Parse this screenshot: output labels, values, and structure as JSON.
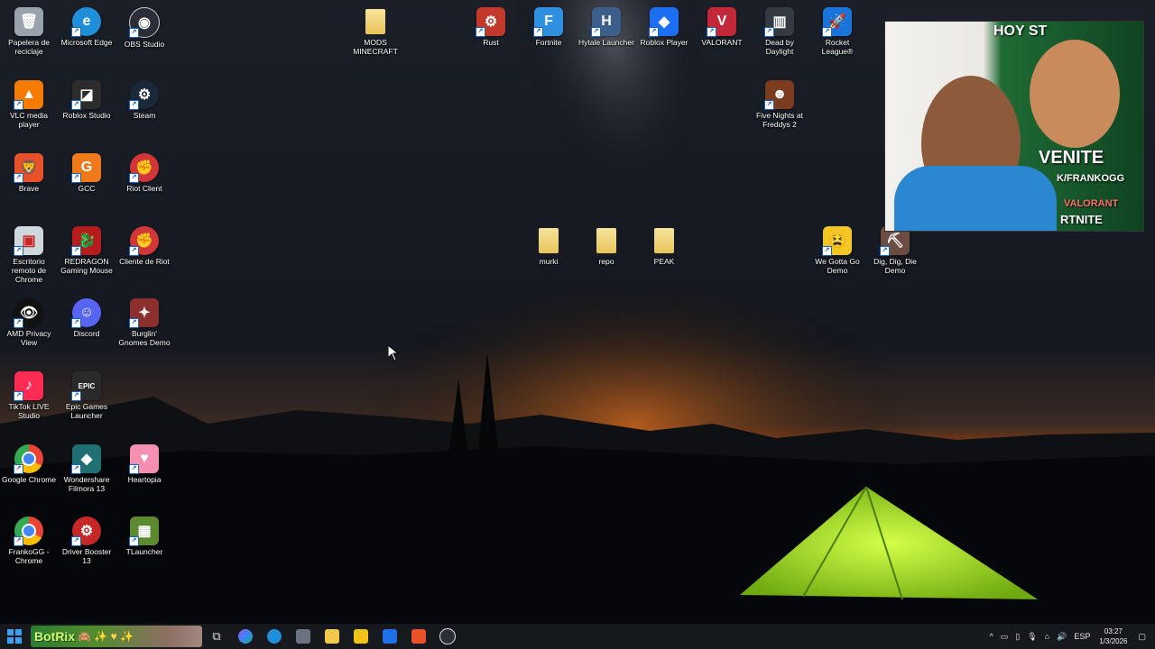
{
  "desktop": {
    "icons": [
      {
        "id": "recycle-bin",
        "label": "Papelera de reciclaje",
        "icon": "recycle-bin-icon",
        "color": "#9aa3ad",
        "glyph": "🗑"
      },
      {
        "id": "microsoft-edge",
        "label": "Microsoft Edge",
        "icon": "edge-icon",
        "color": "#1e8fd8",
        "glyph": "e"
      },
      {
        "id": "obs-studio",
        "label": "OBS Studio",
        "icon": "obs-icon",
        "color": "#2b2e38",
        "glyph": "◉"
      },
      {
        "id": "mods-minecraft",
        "label": "MODS MINECRAFT",
        "icon": "folder-icon",
        "color": "#e8c45a",
        "glyph": ""
      },
      {
        "id": "rust",
        "label": "Rust",
        "icon": "rust-icon",
        "color": "#c0392b",
        "glyph": "⚙"
      },
      {
        "id": "fortnite",
        "label": "Fortnite",
        "icon": "fortnite-icon",
        "color": "#2f8fe0",
        "glyph": "F"
      },
      {
        "id": "hytale-launcher",
        "label": "Hytale Launcher",
        "icon": "hytale-icon",
        "color": "#3b5f8a",
        "glyph": "H"
      },
      {
        "id": "roblox-player",
        "label": "Roblox Player",
        "icon": "roblox-icon",
        "color": "#1c6ef2",
        "glyph": "◆"
      },
      {
        "id": "valorant",
        "label": "VALORANT",
        "icon": "valorant-icon",
        "color": "#c2273a",
        "glyph": "V"
      },
      {
        "id": "dead-by-daylight",
        "label": "Dead by Daylight",
        "icon": "dbd-icon",
        "color": "#333a42",
        "glyph": "▥"
      },
      {
        "id": "rocket-league",
        "label": "Rocket League®",
        "icon": "rocket-league-icon",
        "color": "#1a73d8",
        "glyph": "🚀"
      },
      {
        "id": "vlc",
        "label": "VLC media player",
        "icon": "vlc-icon",
        "color": "#f57c00",
        "glyph": "▲"
      },
      {
        "id": "roblox-studio",
        "label": "Roblox Studio",
        "icon": "roblox-studio-icon",
        "color": "#2c2c2c",
        "glyph": "◪"
      },
      {
        "id": "steam",
        "label": "Steam",
        "icon": "steam-icon",
        "color": "#1b2838",
        "glyph": "⚙"
      },
      {
        "id": "fnaf2",
        "label": "Five Nights at Freddys 2",
        "icon": "fnaf-icon",
        "color": "#7a3b1e",
        "glyph": "☻"
      },
      {
        "id": "brave",
        "label": "Brave",
        "icon": "brave-icon",
        "color": "#e8512a",
        "glyph": "🦁"
      },
      {
        "id": "gcc",
        "label": "GCC",
        "icon": "gcc-icon",
        "color": "#ef7a1b",
        "glyph": "G"
      },
      {
        "id": "riot-client",
        "label": "Riot Client",
        "icon": "riot-icon",
        "color": "#d13639",
        "glyph": "✊"
      },
      {
        "id": "chrome-remote",
        "label": "Escritorio remoto de Chrome",
        "icon": "remote-desktop-icon",
        "color": "#cfd8dc",
        "glyph": "▣"
      },
      {
        "id": "redragon",
        "label": "REDRAGON Gaming Mouse",
        "icon": "redragon-icon",
        "color": "#b71c1c",
        "glyph": "🐉"
      },
      {
        "id": "cliente-riot",
        "label": "Cliente de Riot",
        "icon": "riot-icon",
        "color": "#d13639",
        "glyph": "✊"
      },
      {
        "id": "murki",
        "label": "murki",
        "icon": "folder-icon",
        "color": "#e8c45a",
        "glyph": ""
      },
      {
        "id": "repo",
        "label": "repo",
        "icon": "folder-icon",
        "color": "#e8c45a",
        "glyph": ""
      },
      {
        "id": "peak",
        "label": "PEAK",
        "icon": "folder-icon",
        "color": "#e8c45a",
        "glyph": ""
      },
      {
        "id": "we-gotta-go",
        "label": "We Gotta Go Demo",
        "icon": "we-gotta-go-icon",
        "color": "#f3c623",
        "glyph": "😫"
      },
      {
        "id": "dig-dig-die",
        "label": "Dig, Dig, Die Demo",
        "icon": "dig-dig-die-icon",
        "color": "#6d4c41",
        "glyph": "⛏"
      },
      {
        "id": "amd-privacy",
        "label": "AMD Privacy View",
        "icon": "amd-privacy-icon",
        "color": "#111111",
        "glyph": "👁"
      },
      {
        "id": "discord",
        "label": "Discord",
        "icon": "discord-icon",
        "color": "#5865f2",
        "glyph": "☺"
      },
      {
        "id": "burglin-gnomes",
        "label": "Burglin' Gnomes Demo",
        "icon": "burglin-gnomes-icon",
        "color": "#8e2f2f",
        "glyph": "✦"
      },
      {
        "id": "tiktok-live",
        "label": "TikTok LIVE Studio",
        "icon": "tiktok-icon",
        "color": "#fe2c55",
        "glyph": "♪"
      },
      {
        "id": "epic-games",
        "label": "Epic Games Launcher",
        "icon": "epic-games-icon",
        "color": "#2a2a2a",
        "glyph": "EPIC"
      },
      {
        "id": "google-chrome",
        "label": "Google Chrome",
        "icon": "chrome-icon",
        "color": "#4285f4",
        "glyph": "◎"
      },
      {
        "id": "filmora",
        "label": "Wondershare Filmora 13",
        "icon": "filmora-icon",
        "color": "#1f6f73",
        "glyph": "◆"
      },
      {
        "id": "heartopia",
        "label": "Heartopia",
        "icon": "heartopia-icon",
        "color": "#f48fb1",
        "glyph": "♥"
      },
      {
        "id": "frankogg-chrome",
        "label": "FrankoGG - Chrome",
        "icon": "chrome-icon",
        "color": "#4285f4",
        "glyph": "◎"
      },
      {
        "id": "driver-booster",
        "label": "Driver Booster 13",
        "icon": "driver-booster-icon",
        "color": "#c62828",
        "glyph": "⚙"
      },
      {
        "id": "tlauncher",
        "label": "TLauncher",
        "icon": "tlauncher-icon",
        "color": "#5d8a2e",
        "glyph": "▦"
      }
    ]
  },
  "webcam": {
    "overlay_text_1": "HOY ST",
    "overlay_text_2": "VENITE",
    "overlay_text_3": "K/FRANKOGG",
    "overlay_text_4": "VALORANT",
    "overlay_text_5": "RTNITE"
  },
  "taskbar": {
    "botrix_label": "BotRix",
    "botrix_emojis": "🙈 ✨ ♥ ✨",
    "language": "ESP",
    "time": "03:27",
    "date": "1/3/2026"
  }
}
